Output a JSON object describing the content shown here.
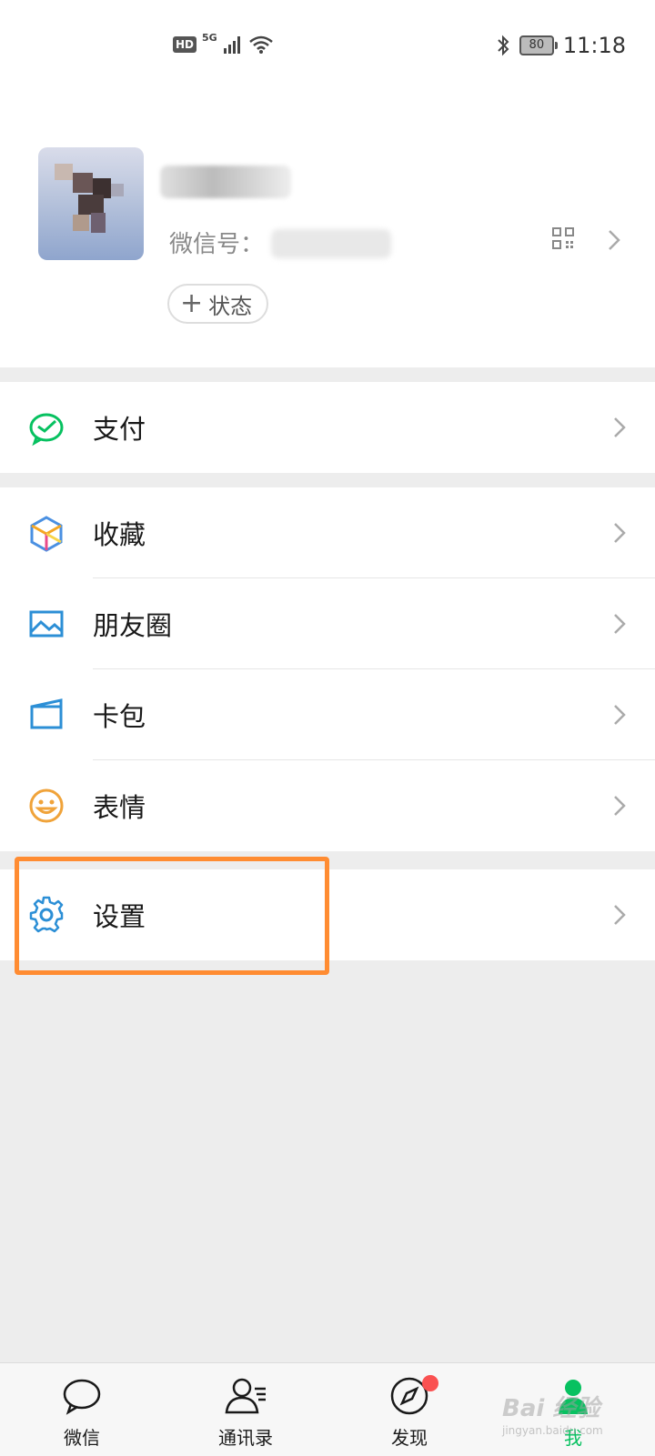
{
  "status_bar": {
    "hd": "HD",
    "network": "5G",
    "battery": "80",
    "time": "11:18"
  },
  "profile": {
    "wechat_id_label": "微信号：",
    "status_button": "状态",
    "status_plus": "+"
  },
  "menu": {
    "pay": "支付",
    "favorites": "收藏",
    "moments": "朋友圈",
    "cards": "卡包",
    "stickers": "表情",
    "settings": "设置"
  },
  "tabs": [
    {
      "label": "微信"
    },
    {
      "label": "通讯录"
    },
    {
      "label": "发现"
    },
    {
      "label": "我"
    }
  ],
  "watermark": {
    "text": "Bai 经验",
    "url": "jingyan.baidu.com"
  },
  "colors": {
    "accent_green": "#07c160",
    "highlight_orange": "#ff8c32",
    "badge_red": "#fa5151"
  }
}
